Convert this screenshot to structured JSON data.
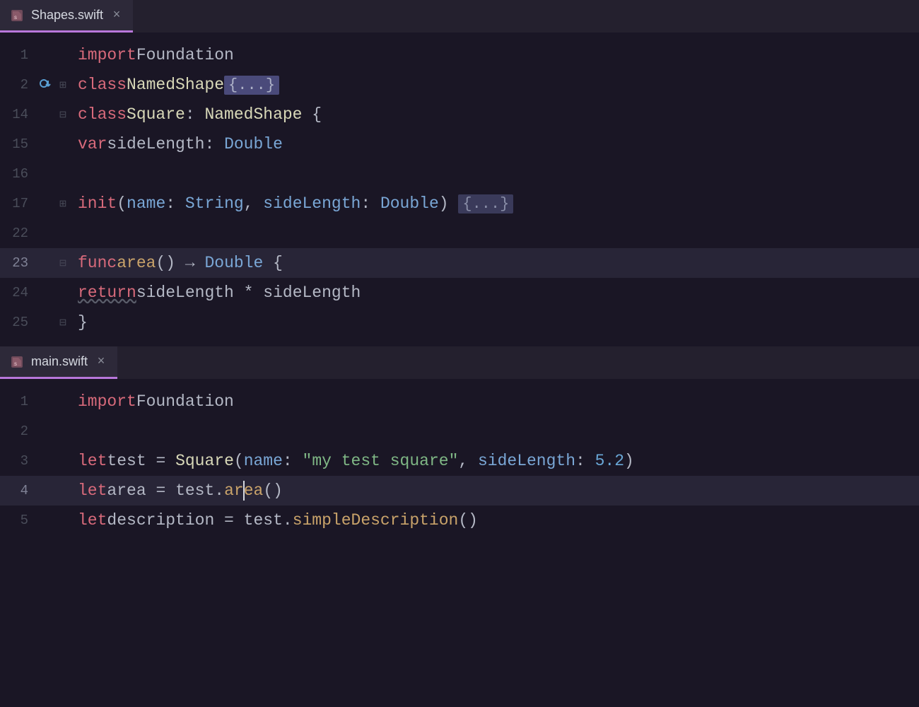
{
  "panes": {
    "top": {
      "tab": {
        "label": "Shapes.swift"
      },
      "lines": [
        {
          "num": "1"
        },
        {
          "num": "2",
          "override": true,
          "fold": "plus"
        },
        {
          "num": "14",
          "fold": "minus"
        },
        {
          "num": "15"
        },
        {
          "num": "16"
        },
        {
          "num": "17",
          "fold": "plus"
        },
        {
          "num": "22"
        },
        {
          "num": "23",
          "fold": "minus",
          "active": true
        },
        {
          "num": "24"
        },
        {
          "num": "25",
          "fold": "minus-end"
        }
      ],
      "code": {
        "l1": {
          "import": "import",
          "foundation": "Foundation"
        },
        "l2": {
          "class": "class",
          "name": "NamedShape",
          "fold": "{...}"
        },
        "l3": {
          "class": "class",
          "name": "Square",
          "colon": ": ",
          "base": "NamedShape",
          "brace": " {"
        },
        "l4": {
          "var": "var",
          "name": "sideLength",
          "colon": ": ",
          "type": "Double"
        },
        "l6": {
          "init": "init",
          "p1": "name",
          "t1": "String",
          "p2": "sideLength",
          "t2": "Double",
          "fold": "{...}"
        },
        "l8": {
          "func": "func",
          "name": "area",
          "arrow": " → ",
          "ret": "Double",
          "brace": " {"
        },
        "l9": {
          "return": "return",
          "expr1": "sideLength",
          "op": " * ",
          "expr2": "sideLength"
        },
        "l10": {
          "brace": "}"
        }
      }
    },
    "bottom": {
      "tab": {
        "label": "main.swift"
      },
      "lines": [
        {
          "num": "1"
        },
        {
          "num": "2"
        },
        {
          "num": "3"
        },
        {
          "num": "4",
          "active": true
        },
        {
          "num": "5"
        }
      ],
      "code": {
        "l1": {
          "import": "import",
          "foundation": "Foundation"
        },
        "l3": {
          "let": "let",
          "name": "test",
          "eq": " = ",
          "ctor": "Square",
          "p1": "name",
          "v1": "\"my test square\"",
          "p2": "sideLength",
          "v2": "5.2"
        },
        "l4": {
          "let": "let",
          "name": "area",
          "eq": " = ",
          "obj": "test",
          "call_a": "ar",
          "call_b": "ea",
          "paren": "()"
        },
        "l5": {
          "let": "let",
          "name": "description",
          "eq": " = ",
          "obj": "test",
          "call": "simpleDescription",
          "paren": "()"
        }
      }
    }
  }
}
